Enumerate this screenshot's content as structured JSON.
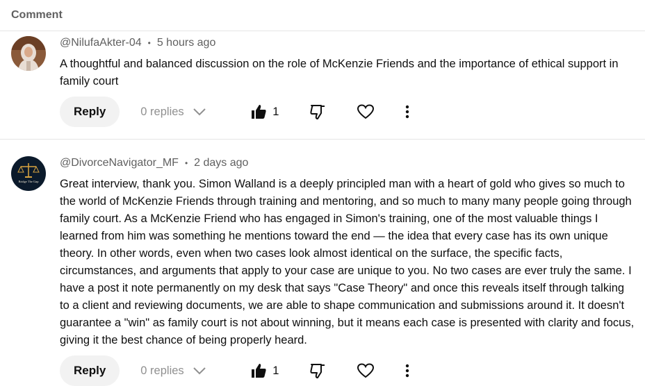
{
  "header": {
    "title": "Comment"
  },
  "comments": [
    {
      "author": "@NilufaAkter-04",
      "time": "5 hours ago",
      "text": "A thoughtful and balanced discussion on the role of McKenzie Friends and the importance of ethical support in family court",
      "reply_label": "Reply",
      "replies_label": "0 replies",
      "likes": "1",
      "avatar_icon": "profile-photo-icon"
    },
    {
      "author": "@DivorceNavigator_MF",
      "time": "2 days ago",
      "text": "Great interview, thank you. Simon Walland is a deeply principled man with a heart of gold who gives so much to the world of McKenzie Friends through training and mentoring, and so much to many many people going through family court.   As a McKenzie Friend who has engaged in Simon's training, one of the most valuable things I learned from him was something he mentions toward the end — the idea that every case has its own unique theory. In other words, even when two cases look almost identical on the surface, the specific facts, circumstances, and arguments that apply to your case are unique to you. No two cases are ever truly the same.  I have a post it note permanently on my desk that says \"Case Theory\" and once this reveals itself through talking to a client and reviewing documents, we are able to shape communication and submissions around it.  It doesn't guarantee a \"win\" as family court is not about winning,  but it means each case is presented with clarity and focus, giving it the best chance of being properly heard.",
      "reply_label": "Reply",
      "replies_label": "0 replies",
      "likes": "1",
      "avatar_icon": "scales-logo-icon",
      "avatar_logo_text": "Bridge The Gap"
    }
  ],
  "colors": {
    "muted": "#606060",
    "reply_bg": "#f2f2f2",
    "divider": "#e5e5e5"
  }
}
